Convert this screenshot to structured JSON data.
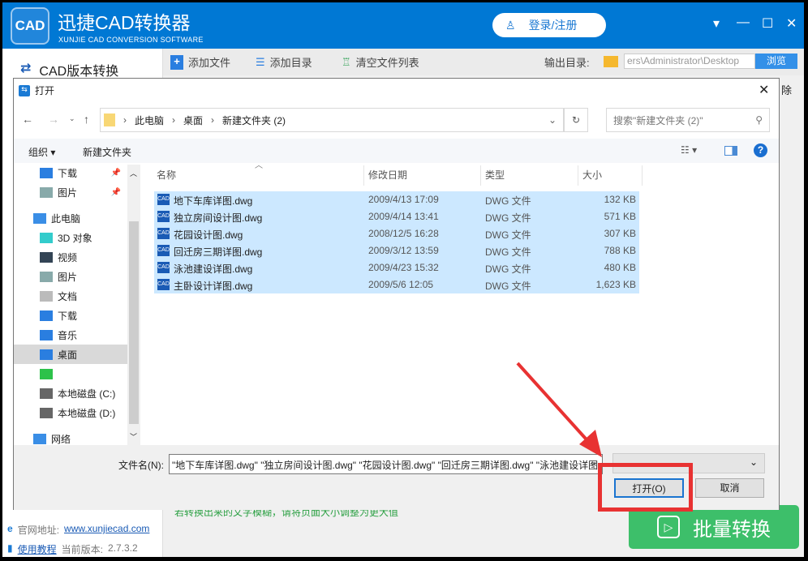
{
  "app": {
    "title": "迅捷CAD转换器",
    "subtitle": "XUNJIE CAD CONVERSION SOFTWARE",
    "logo": "CAD",
    "login": "登录/注册",
    "side_title": "CAD版本转换",
    "toolbar": {
      "add_file": "添加文件",
      "add_dir": "添加目录",
      "clear_list": "清空文件列表",
      "output_label": "输出目录:",
      "output_path": "ers\\Administrator\\Desktop",
      "browse": "浏览"
    },
    "partial_delete": "除",
    "hint": "若转换出来的文字模糊，请将页面大小调整为更大值",
    "website_label": "官网地址:",
    "website": "www.xunjiecad.com",
    "tutorial": "使用教程",
    "version_label": "当前版本:",
    "version": "2.7.3.2",
    "convert_button": "批量转换"
  },
  "dialog": {
    "title": "打开",
    "breadcrumb": [
      "此电脑",
      "桌面",
      "新建文件夹 (2)"
    ],
    "search_placeholder": "搜索\"新建文件夹 (2)\"",
    "organize": "组织",
    "new_folder": "新建文件夹",
    "nav": [
      {
        "label": "下载",
        "icon": "download-icon",
        "pin": true
      },
      {
        "label": "图片",
        "icon": "pictures-icon",
        "pin": true
      },
      {
        "label": "此电脑",
        "icon": "computer-icon",
        "top": true
      },
      {
        "label": "3D 对象",
        "icon": "3d-objects-icon"
      },
      {
        "label": "视频",
        "icon": "video-icon"
      },
      {
        "label": "图片",
        "icon": "pictures-icon"
      },
      {
        "label": "文档",
        "icon": "documents-icon"
      },
      {
        "label": "下载",
        "icon": "download-icon"
      },
      {
        "label": "音乐",
        "icon": "music-icon"
      },
      {
        "label": "桌面",
        "icon": "desktop-icon",
        "selected": true
      },
      {
        "label": "",
        "icon": "app-drive-icon"
      },
      {
        "label": "本地磁盘 (C:)",
        "icon": "drive-icon"
      },
      {
        "label": "本地磁盘 (D:)",
        "icon": "drive-icon"
      },
      {
        "label": "网络",
        "icon": "network-icon",
        "top": true
      }
    ],
    "columns": [
      "名称",
      "修改日期",
      "类型",
      "大小"
    ],
    "files": [
      {
        "name": "地下车库详图.dwg",
        "date": "2009/4/13 17:09",
        "type": "DWG 文件",
        "size": "132 KB"
      },
      {
        "name": "独立房间设计图.dwg",
        "date": "2009/4/14 13:41",
        "type": "DWG 文件",
        "size": "571 KB"
      },
      {
        "name": "花园设计图.dwg",
        "date": "2008/12/5 16:28",
        "type": "DWG 文件",
        "size": "307 KB"
      },
      {
        "name": "回迁房三期详图.dwg",
        "date": "2009/3/12 13:59",
        "type": "DWG 文件",
        "size": "788 KB"
      },
      {
        "name": "泳池建设详图.dwg",
        "date": "2009/4/23 15:32",
        "type": "DWG 文件",
        "size": "480 KB"
      },
      {
        "name": "主卧设计详图.dwg",
        "date": "2009/5/6 12:05",
        "type": "DWG 文件",
        "size": "1,623 KB"
      }
    ],
    "filename_label": "文件名(N):",
    "filename_value": "\"地下车库详图.dwg\" \"独立房间设计图.dwg\" \"花园设计图.dwg\" \"回迁房三期详图.dwg\" \"泳池建设详图.dwg\" \"主卧设计详图.dwg\"",
    "open": "打开(O)",
    "cancel": "取消"
  },
  "colors": {
    "brand": "#0078d4",
    "selection": "#cce8ff",
    "highlight": "#e83232",
    "convert": "#3dbf6a"
  }
}
